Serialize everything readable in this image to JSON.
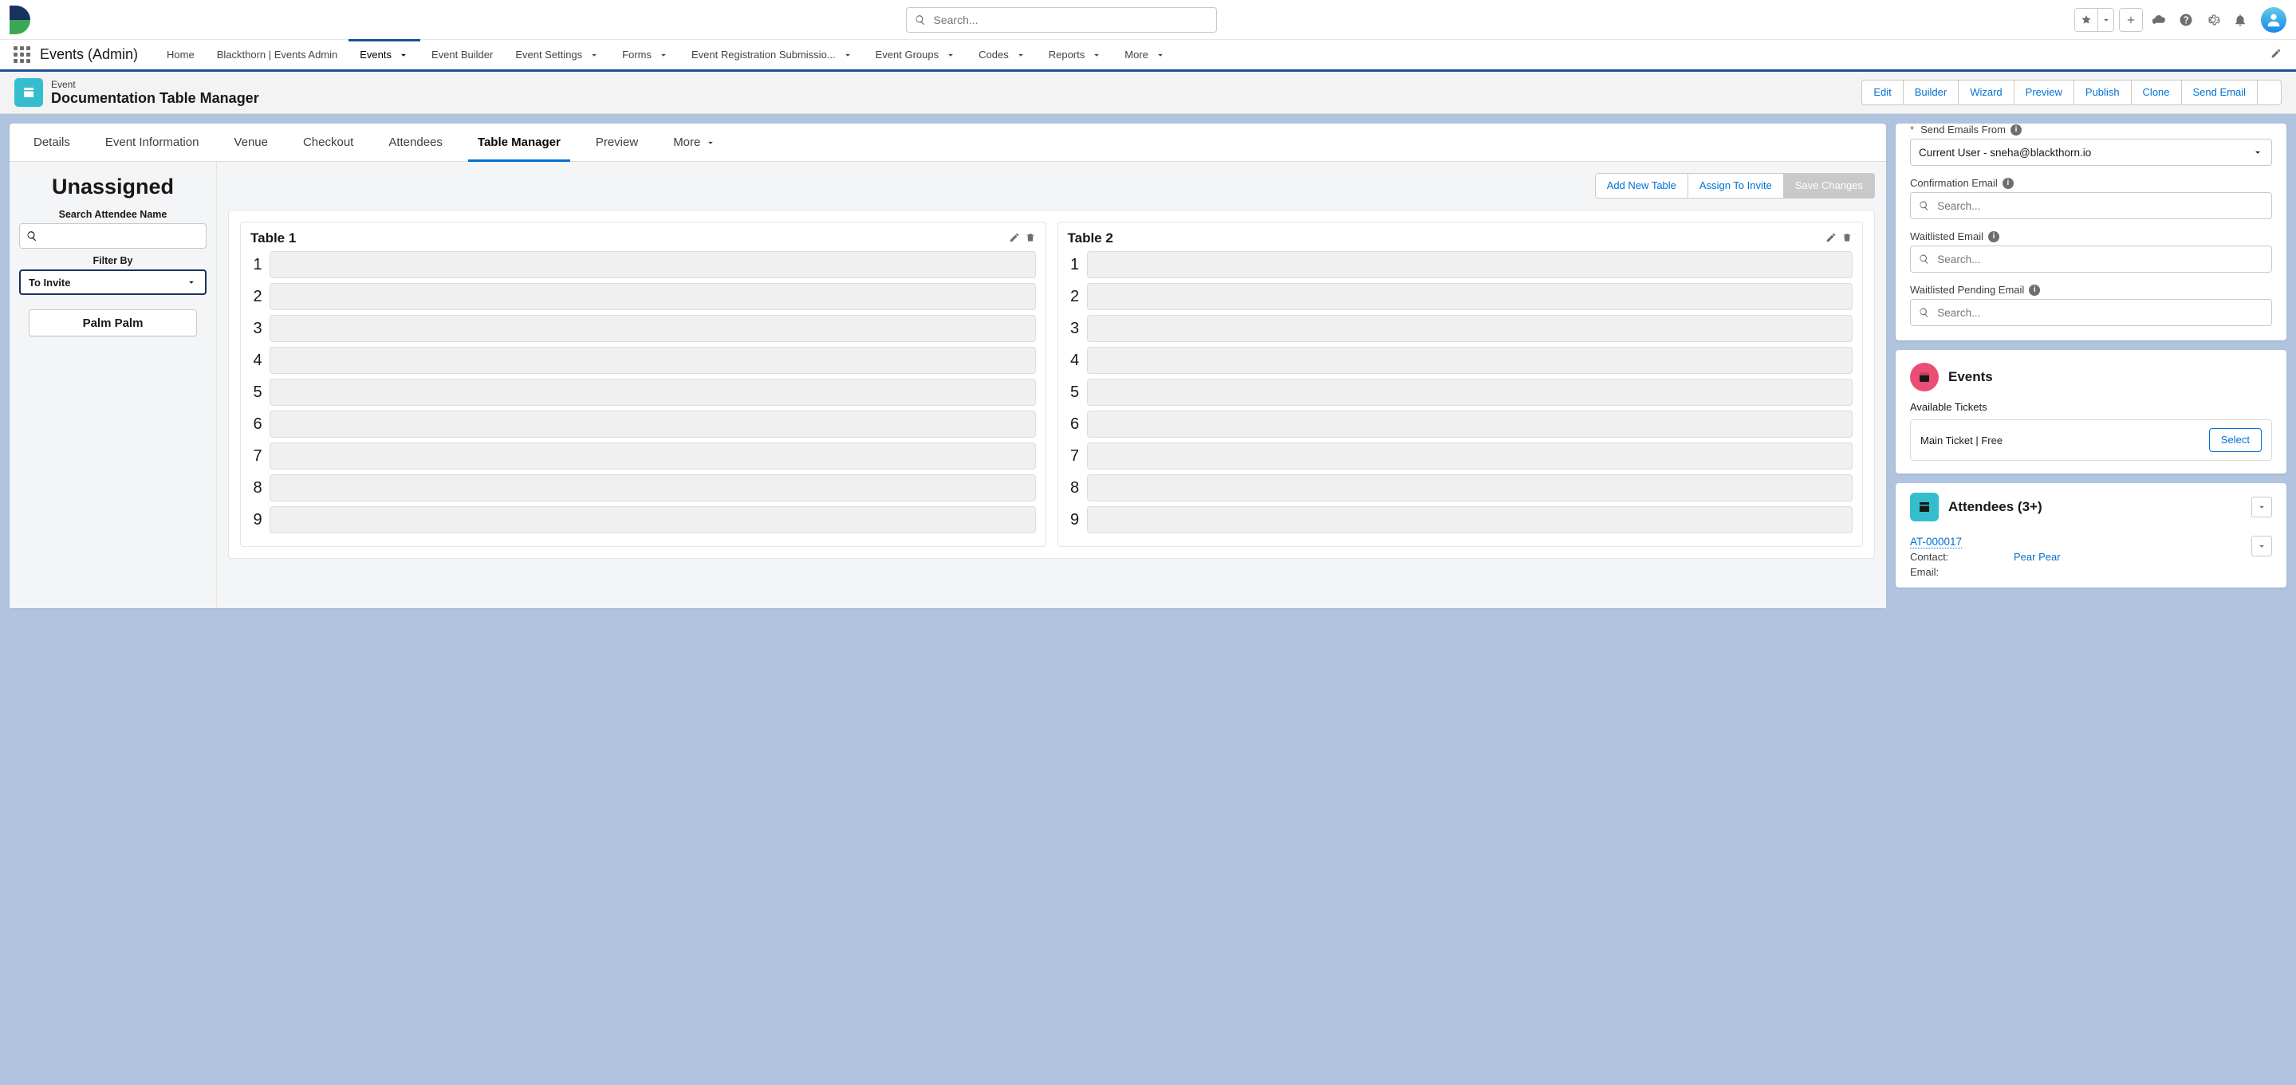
{
  "global": {
    "searchPlaceholder": "Search...",
    "appName": "Events (Admin)"
  },
  "nav": [
    {
      "label": "Home",
      "chev": false,
      "active": false
    },
    {
      "label": "Blackthorn | Events Admin",
      "chev": false,
      "active": false
    },
    {
      "label": "Events",
      "chev": true,
      "active": true
    },
    {
      "label": "Event Builder",
      "chev": false,
      "active": false
    },
    {
      "label": "Event Settings",
      "chev": true,
      "active": false
    },
    {
      "label": "Forms",
      "chev": true,
      "active": false
    },
    {
      "label": "Event Registration Submissio...",
      "chev": true,
      "active": false
    },
    {
      "label": "Event Groups",
      "chev": true,
      "active": false
    },
    {
      "label": "Codes",
      "chev": true,
      "active": false
    },
    {
      "label": "Reports",
      "chev": true,
      "active": false
    },
    {
      "label": "More",
      "chev": true,
      "active": false
    }
  ],
  "record": {
    "eyebrow": "Event",
    "title": "Documentation Table Manager",
    "actions": [
      "Edit",
      "Builder",
      "Wizard",
      "Preview",
      "Publish",
      "Clone",
      "Send Email"
    ]
  },
  "detailTabs": [
    {
      "label": "Details",
      "active": false
    },
    {
      "label": "Event Information",
      "active": false
    },
    {
      "label": "Venue",
      "active": false
    },
    {
      "label": "Checkout",
      "active": false
    },
    {
      "label": "Attendees",
      "active": false
    },
    {
      "label": "Table Manager",
      "active": true
    },
    {
      "label": "Preview",
      "active": false
    }
  ],
  "detailMore": "More",
  "tm": {
    "unassignedTitle": "Unassigned",
    "searchLabel": "Search Attendee Name",
    "filterLabel": "Filter By",
    "filterValue": "To Invite",
    "unassigned": [
      {
        "name": "Palm Palm"
      }
    ],
    "toolbar": {
      "add": "Add New Table",
      "assign": "Assign To Invite",
      "save": "Save Changes"
    },
    "tables": [
      {
        "name": "Table 1",
        "seats": 9
      },
      {
        "name": "Table 2",
        "seats": 9
      }
    ]
  },
  "emails": {
    "sendFromLabel": "Send Emails From",
    "sendFromValue": "Current User - sneha@blackthorn.io",
    "confirmLabel": "Confirmation Email",
    "waitLabel": "Waitlisted Email",
    "waitPendLabel": "Waitlisted Pending Email",
    "searchPlaceholder": "Search..."
  },
  "events": {
    "title": "Events",
    "sub": "Available Tickets",
    "ticket": "Main Ticket | Free",
    "select": "Select"
  },
  "attendees": {
    "title": "Attendees (3+)",
    "records": [
      {
        "id": "AT-000017",
        "contactLabel": "Contact:",
        "contact": "Pear Pear",
        "emailLabel": "Email:"
      }
    ]
  }
}
